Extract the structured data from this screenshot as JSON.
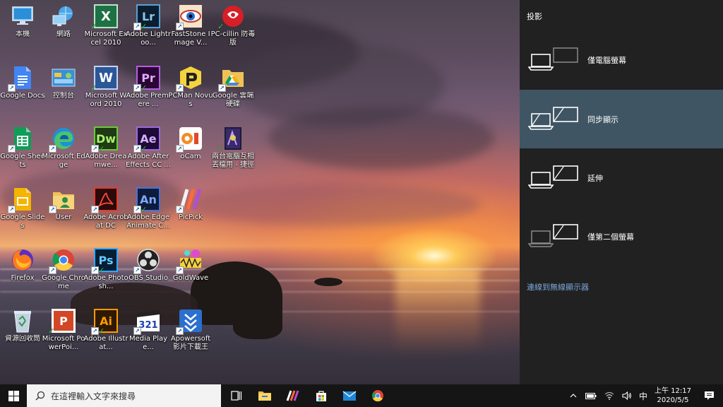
{
  "desktop_icons": [
    {
      "id": "pc",
      "label": "本機",
      "col": 0,
      "row": 0
    },
    {
      "id": "network",
      "label": "網路",
      "col": 1,
      "row": 0
    },
    {
      "id": "excel",
      "label": "Microsoft Excel 2010",
      "col": 2,
      "row": 0
    },
    {
      "id": "lightroom",
      "label": "Adobe Lightroo...",
      "col": 3,
      "row": 0
    },
    {
      "id": "faststone",
      "label": "FastStone Image V...",
      "col": 4,
      "row": 0
    },
    {
      "id": "pccillin",
      "label": "PC-cillin 防毒版",
      "col": 5,
      "row": 0
    },
    {
      "id": "gdocs",
      "label": "Google Docs",
      "col": 0,
      "row": 1
    },
    {
      "id": "control",
      "label": "控制台",
      "col": 1,
      "row": 1
    },
    {
      "id": "word",
      "label": "Microsoft Word 2010",
      "col": 2,
      "row": 1
    },
    {
      "id": "premiere",
      "label": "Adobe Premiere ...",
      "col": 3,
      "row": 1
    },
    {
      "id": "pcman",
      "label": "PCMan Novus",
      "col": 4,
      "row": 1
    },
    {
      "id": "gdrive",
      "label": "Google 雲端硬碟",
      "col": 5,
      "row": 1
    },
    {
      "id": "gsheets",
      "label": "Google Sheets",
      "col": 0,
      "row": 2
    },
    {
      "id": "edge",
      "label": "Microsoft Edge",
      "col": 1,
      "row": 2
    },
    {
      "id": "dreamweaver",
      "label": "Adobe Dreamwe...",
      "col": 2,
      "row": 2
    },
    {
      "id": "aftereffects",
      "label": "Adobe After Effects CC ...",
      "col": 3,
      "row": 2
    },
    {
      "id": "ocam",
      "label": "oCam",
      "col": 4,
      "row": 2
    },
    {
      "id": "twopc",
      "label": "兩台電腦互相丟檔用 - 捷徑",
      "col": 5,
      "row": 2
    },
    {
      "id": "gslides",
      "label": "Google Slides",
      "col": 0,
      "row": 3
    },
    {
      "id": "user",
      "label": "User",
      "col": 1,
      "row": 3
    },
    {
      "id": "acrobat",
      "label": "Adobe Acrobat DC",
      "col": 2,
      "row": 3
    },
    {
      "id": "animate",
      "label": "Adobe Edge Animate C...",
      "col": 3,
      "row": 3
    },
    {
      "id": "picpick",
      "label": "PicPick",
      "col": 4,
      "row": 3
    },
    {
      "id": "firefox",
      "label": "Firefox",
      "col": 0,
      "row": 4
    },
    {
      "id": "chrome",
      "label": "Google Chrome",
      "col": 1,
      "row": 4
    },
    {
      "id": "photoshop",
      "label": "Adobe Photosh...",
      "col": 2,
      "row": 4
    },
    {
      "id": "obs",
      "label": "OBS Studio",
      "col": 3,
      "row": 4
    },
    {
      "id": "goldwave",
      "label": "GoldWave",
      "col": 4,
      "row": 4
    },
    {
      "id": "recycle",
      "label": "資源回收筒",
      "col": 0,
      "row": 5
    },
    {
      "id": "powerpoint",
      "label": "Microsoft PowerPoi...",
      "col": 1,
      "row": 5
    },
    {
      "id": "illustrator",
      "label": "Adobe Illustrat...",
      "col": 2,
      "row": 5
    },
    {
      "id": "mediaplayer",
      "label": "Media Playe...",
      "col": 3,
      "row": 5
    },
    {
      "id": "apowersoft",
      "label": "Apowersoft 影片下載王",
      "col": 4,
      "row": 5
    }
  ],
  "project_panel": {
    "title": "投影",
    "options": [
      {
        "id": "pc-only",
        "label": "僅電腦螢幕",
        "selected": false
      },
      {
        "id": "duplicate",
        "label": "同步顯示",
        "selected": true
      },
      {
        "id": "extend",
        "label": "延伸",
        "selected": false
      },
      {
        "id": "second-only",
        "label": "僅第二個螢幕",
        "selected": false
      }
    ],
    "wireless_link": "連線到無線顯示器"
  },
  "taskbar": {
    "search_placeholder": "在這裡輸入文字來搜尋",
    "ime": "中",
    "time": "上午 12:17",
    "date": "2020/5/5"
  },
  "colors": {
    "panel_bg": "#212121",
    "selected_bg": "#3f5563",
    "link": "#7aa6d8",
    "taskbar_bg": "#151515"
  }
}
